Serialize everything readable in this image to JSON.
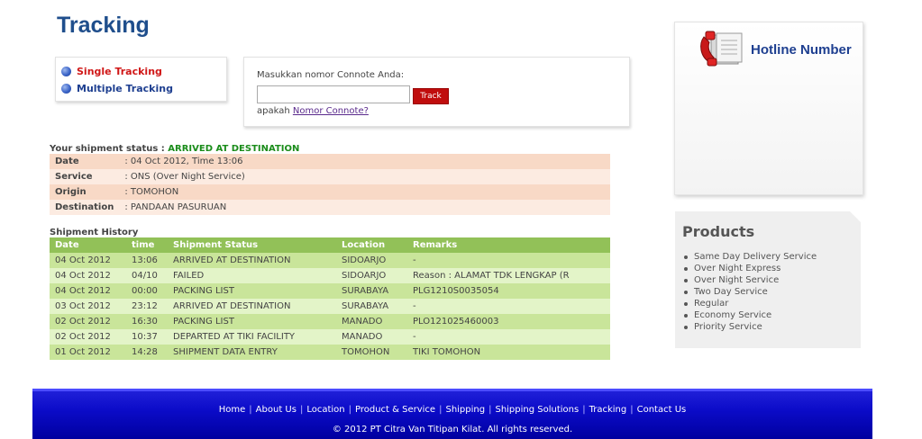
{
  "page": {
    "title": "Tracking"
  },
  "tracking_menu": {
    "items": [
      {
        "label": "Single Tracking",
        "active": true
      },
      {
        "label": "Multiple Tracking",
        "active": false
      }
    ]
  },
  "track_form": {
    "prompt": "Masukkan nomor Connote Anda:",
    "input_value": "",
    "button_label": "Track",
    "hint_prefix": "apakah ",
    "hint_link": "Nomor Connote?"
  },
  "shipment_status": {
    "label": "Your shipment status : ",
    "value": "ARRIVED AT DESTINATION",
    "rows": [
      {
        "key": "Date",
        "value": ": 04 Oct 2012, Time 13:06"
      },
      {
        "key": "Service",
        "value": ": ONS (Over Night Service)"
      },
      {
        "key": "Origin",
        "value": ": TOMOHON"
      },
      {
        "key": "Destination",
        "value": ": PANDAAN PASURUAN"
      }
    ]
  },
  "history": {
    "title": "Shipment History",
    "columns": [
      "Date",
      "time",
      "Shipment Status",
      "Location",
      "Remarks"
    ],
    "rows": [
      [
        "04 Oct 2012",
        "13:06",
        "ARRIVED AT DESTINATION",
        "SIDOARJO",
        "-"
      ],
      [
        "04 Oct 2012",
        "04/10",
        "FAILED",
        "SIDOARJO",
        "Reason : ALAMAT TDK LENGKAP (R"
      ],
      [
        "04 Oct 2012",
        "00:00",
        "PACKING LIST",
        "SURABAYA",
        "PLG1210S0035054"
      ],
      [
        "03 Oct 2012",
        "23:12",
        "ARRIVED AT DESTINATION",
        "SURABAYA",
        "-"
      ],
      [
        "02 Oct 2012",
        "16:30",
        "PACKING LIST",
        "MANADO",
        "PLO121025460003"
      ],
      [
        "02 Oct 2012",
        "10:37",
        "DEPARTED AT TIKI FACILITY",
        "MANADO",
        "-"
      ],
      [
        "01 Oct 2012",
        "14:28",
        "SHIPMENT DATA ENTRY",
        "TOMOHON",
        "TIKI TOMOHON"
      ]
    ]
  },
  "hotline": {
    "title": "Hotline Number",
    "icon": "phone-book-icon"
  },
  "products": {
    "title": "Products",
    "items": [
      "Same Day Delivery Service",
      "Over Night Express",
      "Over Night Service",
      "Two Day Service",
      "Regular",
      "Economy Service",
      "Priority Service"
    ]
  },
  "footer": {
    "links": [
      "Home",
      "About Us",
      "Location",
      "Product & Service",
      "Shipping",
      "Shipping Solutions",
      "Tracking",
      "Contact Us"
    ],
    "separator": "|",
    "copyright": "© 2012 PT Citra Van Titipan Kilat. All rights reserved."
  },
  "colors": {
    "title": "#1f4e8c",
    "active_menu": "#d01717",
    "status_ok": "#1a8c1a",
    "history_header": "#92c158",
    "footer": "#0b0bc8"
  }
}
